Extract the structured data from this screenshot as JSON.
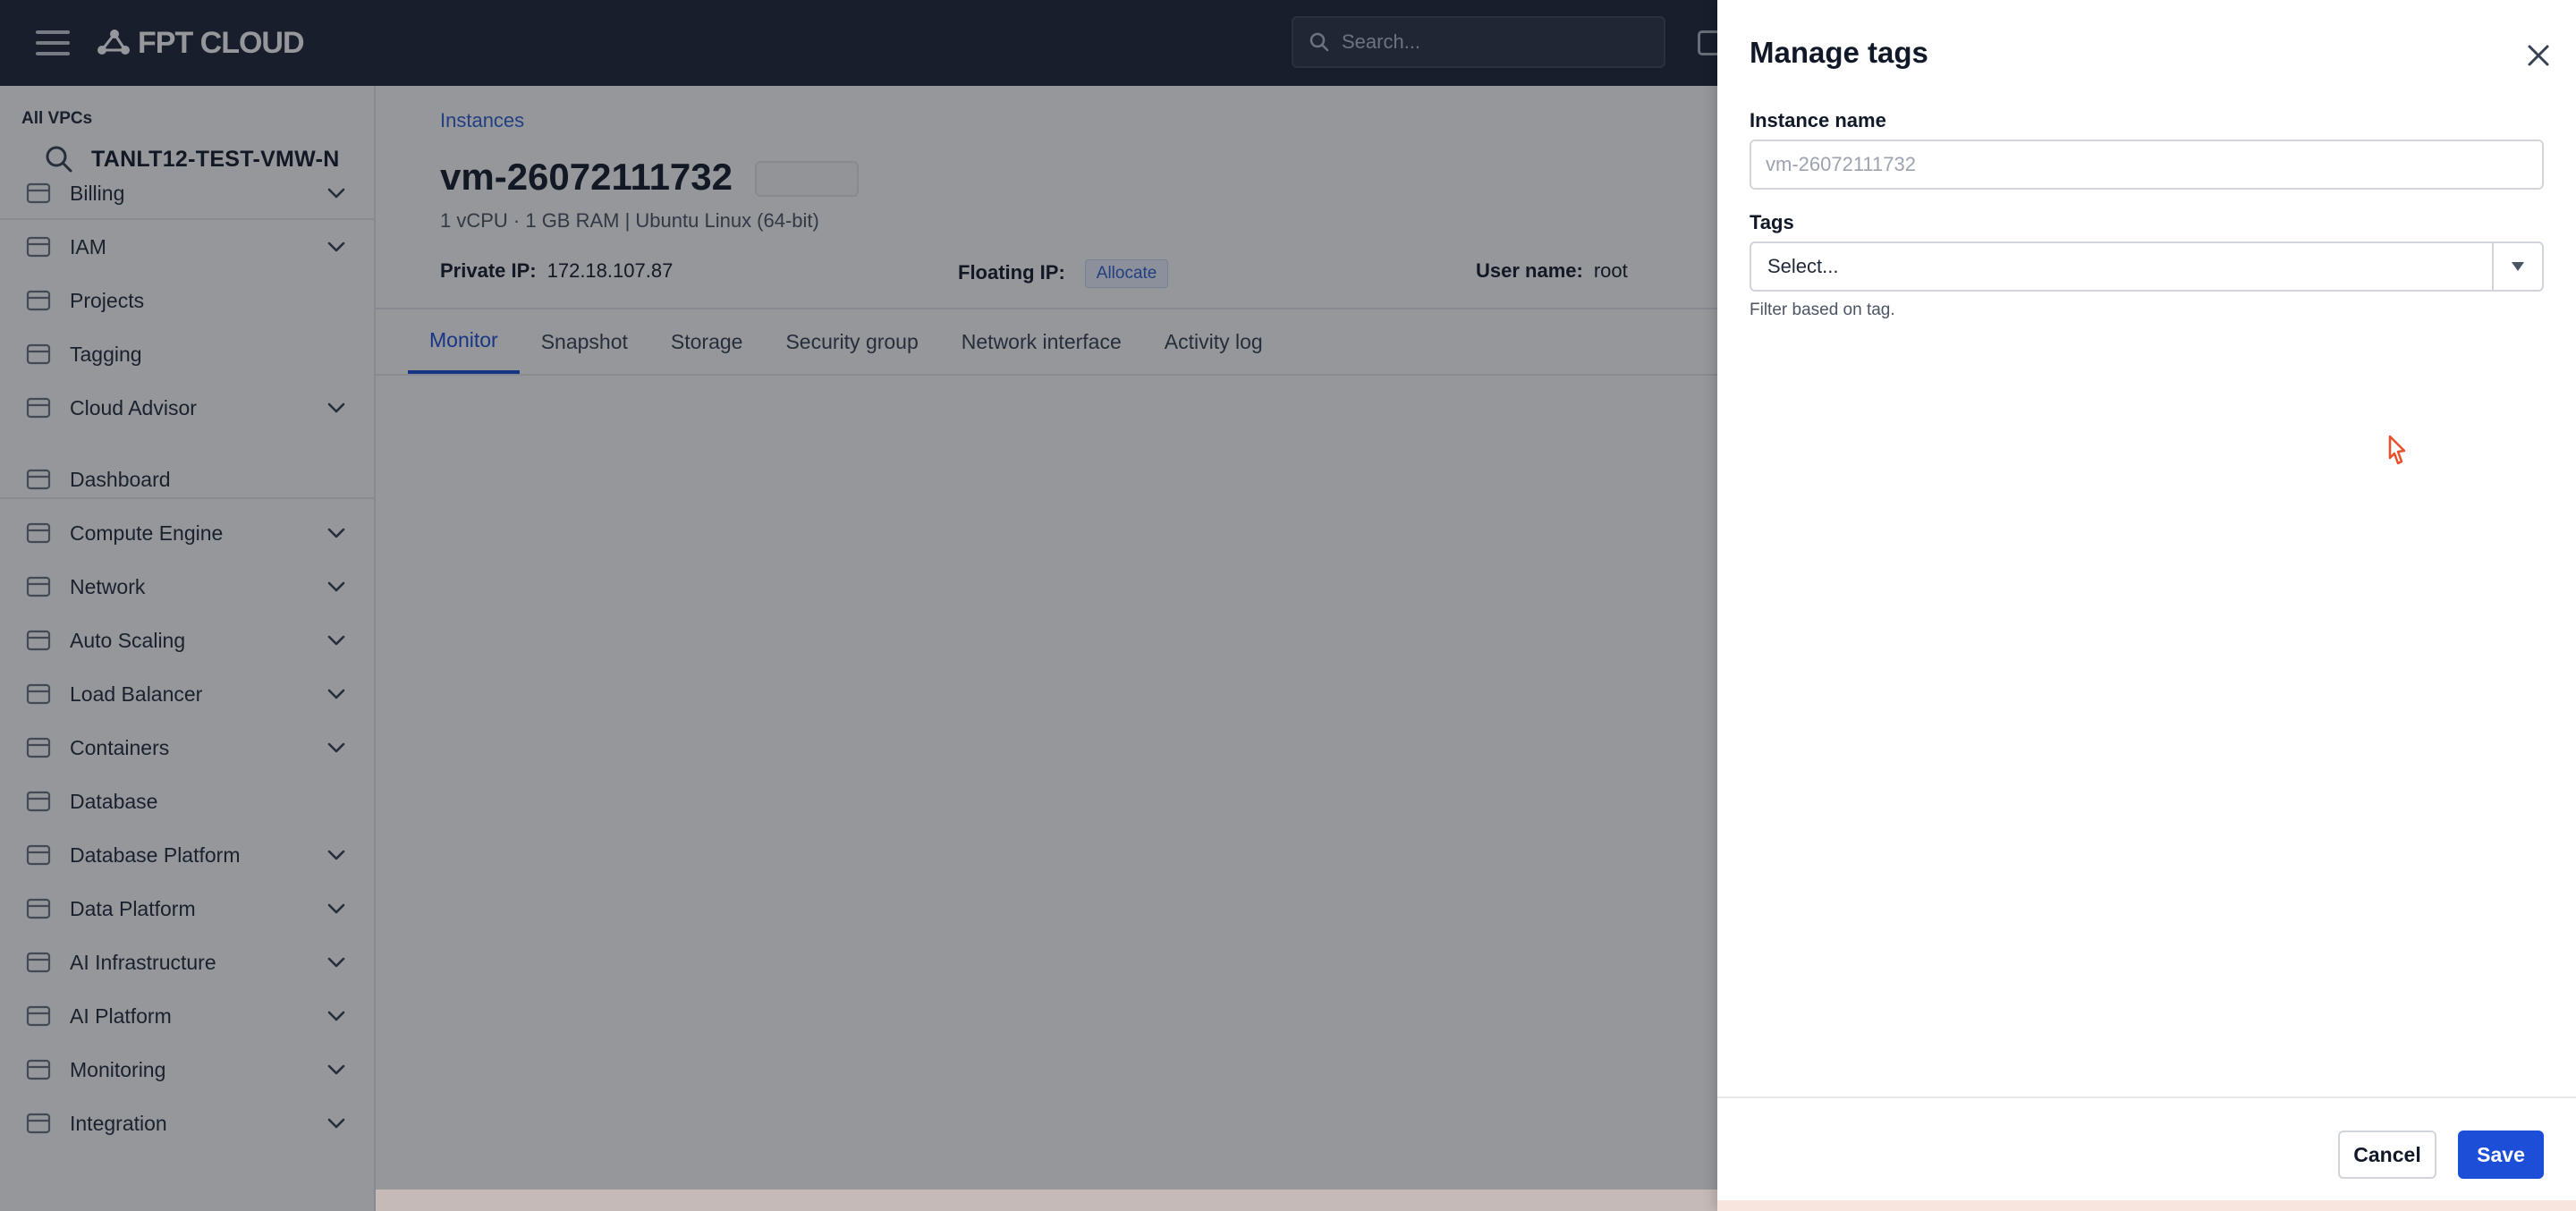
{
  "header": {
    "logo_text": "FPT CLOUD",
    "search_placeholder": "Search..."
  },
  "sidebar": {
    "vpc_label": "All VPCs",
    "vpc_name": "TANLT12-TEST-VMW-N",
    "items": [
      {
        "label": "Billing",
        "icon": "billing-icon",
        "expandable": true
      },
      {
        "label": "IAM",
        "icon": "iam-icon",
        "expandable": true
      },
      {
        "label": "Projects",
        "icon": "projects-icon",
        "expandable": false
      },
      {
        "label": "Tagging",
        "icon": "tag-icon",
        "expandable": false
      },
      {
        "label": "Cloud Advisor",
        "icon": "cloud-advisor-icon",
        "expandable": true
      },
      {
        "label": "Dashboard",
        "icon": "dashboard-icon",
        "expandable": false
      },
      {
        "label": "Compute Engine",
        "icon": "compute-icon",
        "expandable": true
      },
      {
        "label": "Network",
        "icon": "network-icon",
        "expandable": true
      },
      {
        "label": "Auto Scaling",
        "icon": "auto-scaling-icon",
        "expandable": true
      },
      {
        "label": "Load Balancer",
        "icon": "load-balancer-icon",
        "expandable": true
      },
      {
        "label": "Containers",
        "icon": "containers-icon",
        "expandable": true
      },
      {
        "label": "Database",
        "icon": "database-icon",
        "expandable": false
      },
      {
        "label": "Database Platform",
        "icon": "database-platform-icon",
        "expandable": true
      },
      {
        "label": "Data Platform",
        "icon": "data-platform-icon",
        "expandable": true
      },
      {
        "label": "AI Infrastructure",
        "icon": "ai-infrastructure-icon",
        "expandable": true
      },
      {
        "label": "AI Platform",
        "icon": "ai-platform-icon",
        "expandable": true
      },
      {
        "label": "Monitoring",
        "icon": "monitoring-icon",
        "expandable": true
      },
      {
        "label": "Integration",
        "icon": "integration-icon",
        "expandable": true
      }
    ]
  },
  "main": {
    "breadcrumb": "Instances",
    "title": "vm-26072111732",
    "subtitle": "1 vCPU · 1 GB RAM | Ubuntu Linux (64-bit)",
    "private_ip_label": "Private IP:",
    "private_ip": "172.18.107.87",
    "floating_ip_label": "Floating IP:",
    "floating_ip_action": "Allocate",
    "username_label": "User name:",
    "username": "root",
    "tabs": [
      {
        "label": "Monitor",
        "active": true
      },
      {
        "label": "Snapshot",
        "active": false
      },
      {
        "label": "Storage",
        "active": false
      },
      {
        "label": "Security group",
        "active": false
      },
      {
        "label": "Network interface",
        "active": false
      },
      {
        "label": "Activity log",
        "active": false
      }
    ]
  },
  "drawer": {
    "title": "Manage tags",
    "instance_name_label": "Instance name",
    "instance_name_value": "vm-26072111732",
    "tags_label": "Tags",
    "tags_placeholder": "Select...",
    "help_text": "Filter based on tag.",
    "cancel_label": "Cancel",
    "save_label": "Save"
  },
  "colors": {
    "header_bg": "#1c2434",
    "accent": "#1d4ed8",
    "link": "#2f5fd0"
  }
}
